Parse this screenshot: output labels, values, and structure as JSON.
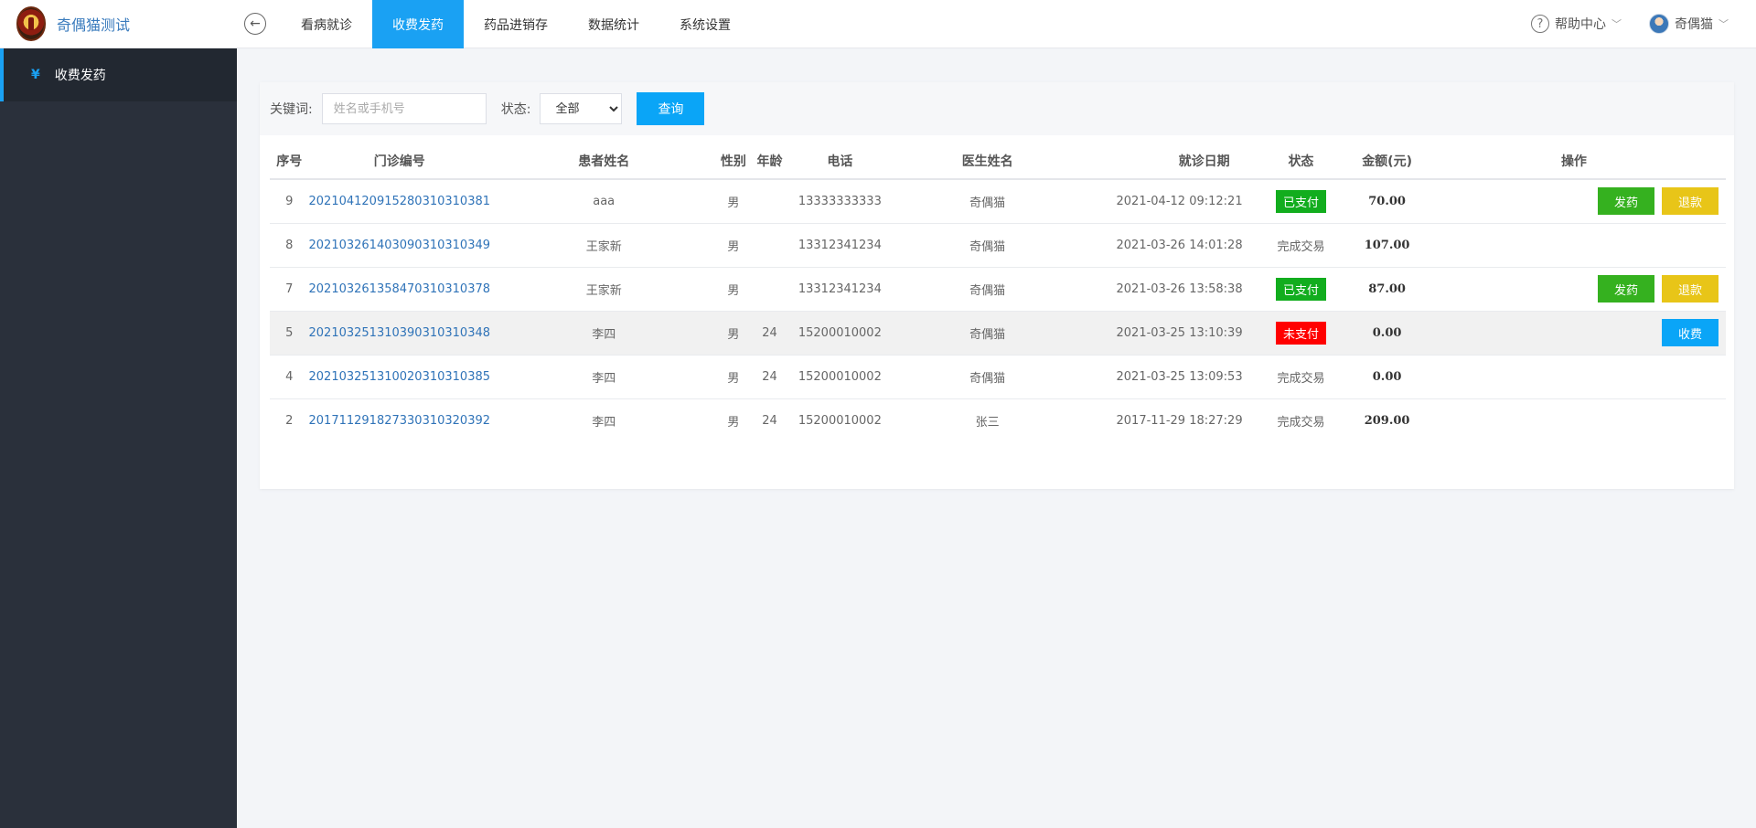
{
  "app": {
    "title": "奇偶猫测试"
  },
  "nav": {
    "items": [
      {
        "label": "看病就诊",
        "active": false
      },
      {
        "label": "收费发药",
        "active": true
      },
      {
        "label": "药品进销存",
        "active": false
      },
      {
        "label": "数据统计",
        "active": false
      },
      {
        "label": "系统设置",
        "active": false
      }
    ]
  },
  "header": {
    "help_label": "帮助中心",
    "user_name": "奇偶猫"
  },
  "sidebar": {
    "items": [
      {
        "label": "收费发药",
        "icon": "yen-icon"
      }
    ]
  },
  "filter": {
    "keyword_label": "关键词:",
    "keyword_placeholder": "姓名或手机号",
    "keyword_value": "",
    "status_label": "状态:",
    "status_value": "全部",
    "query_label": "查询"
  },
  "table": {
    "headers": [
      "序号",
      "门诊编号",
      "患者姓名",
      "性别",
      "年龄",
      "电话",
      "医生姓名",
      "就诊日期",
      "状态",
      "金额(元)",
      "操作"
    ],
    "rows": [
      {
        "no": "9",
        "clinic_id": "20210412091528031031​0381",
        "patient": "aaa",
        "gender": "男",
        "age": "",
        "phone": "13333333333",
        "doctor": "奇偶猫",
        "date": "2021-04-12 09:12:21",
        "status": "已支付",
        "status_type": "paid",
        "amount": "70.00",
        "actions": [
          "发药",
          "退款"
        ]
      },
      {
        "no": "8",
        "clinic_id": "202103261403090310310349",
        "patient": "王家新",
        "gender": "男",
        "age": "",
        "phone": "13312341234",
        "doctor": "奇偶猫",
        "date": "2021-03-26 14:01:28",
        "status": "完成交易",
        "status_type": "done",
        "amount": "107.00",
        "actions": []
      },
      {
        "no": "7",
        "clinic_id": "202103261358470310310378",
        "patient": "王家新",
        "gender": "男",
        "age": "",
        "phone": "13312341234",
        "doctor": "奇偶猫",
        "date": "2021-03-26 13:58:38",
        "status": "已支付",
        "status_type": "paid",
        "amount": "87.00",
        "actions": [
          "发药",
          "退款"
        ]
      },
      {
        "no": "5",
        "clinic_id": "202103251310390310310348",
        "patient": "李四",
        "gender": "男",
        "age": "24",
        "phone": "15200010002",
        "doctor": "奇偶猫",
        "date": "2021-03-25 13:10:39",
        "status": "未支付",
        "status_type": "unpaid",
        "amount": "0.00",
        "actions": [
          "收费"
        ]
      },
      {
        "no": "4",
        "clinic_id": "202103251310020310310385",
        "patient": "李四",
        "gender": "男",
        "age": "24",
        "phone": "15200010002",
        "doctor": "奇偶猫",
        "date": "2021-03-25 13:09:53",
        "status": "完成交易",
        "status_type": "done",
        "amount": "0.00",
        "actions": []
      },
      {
        "no": "2",
        "clinic_id": "201711291827330310320392",
        "patient": "李四",
        "gender": "男",
        "age": "24",
        "phone": "15200010002",
        "doctor": "张三",
        "date": "2017-11-29 18:27:29",
        "status": "完成交易",
        "status_type": "done",
        "amount": "209.00",
        "actions": []
      }
    ]
  }
}
